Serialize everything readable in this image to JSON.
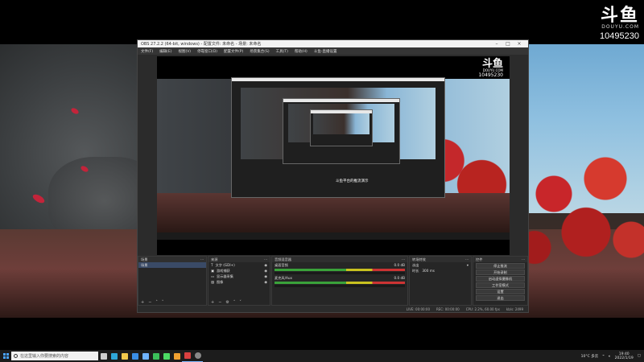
{
  "watermark": {
    "logo": "斗鱼",
    "sub": "DOUYU.COM",
    "room_id": "10495230"
  },
  "obs": {
    "title": "OBS 27.2.2 (64-bit, windows) - 配置文件: 未命名 - 场景: 未命名",
    "menu": [
      "文件(F)",
      "编辑(E)",
      "视图(V)",
      "停靠窗口(D)",
      "配置文件(P)",
      "场景集合(S)",
      "工具(T)",
      "帮助(H)",
      "斗鱼-直播设置"
    ],
    "preview_logo": {
      "logo": "斗鱼",
      "sub": "DOUYU.COM",
      "room_id": "10495230"
    },
    "preview_caption": "斗鱼平台的推流演示",
    "scenes_header": "场景",
    "scenes": [
      "场景"
    ],
    "sources_header": "来源",
    "sources": [
      "文字 (GDI+)",
      "游戏捕获",
      "显示器采集",
      "图像"
    ],
    "mixer_header": "音频混音器",
    "mixer_channels": [
      {
        "name": "桌面音频",
        "db": "0.0 dB"
      },
      {
        "name": "麦克风/Aux",
        "db": "0.0 dB"
      }
    ],
    "transitions_header": "转场特效",
    "transition_type": "淡出",
    "duration_label": "时长",
    "duration_value": "300 ms",
    "controls_header": "控件",
    "controls": [
      "停止推流",
      "开始录制",
      "启动虚拟摄像机",
      "工作室模式",
      "设置",
      "退出"
    ],
    "status": {
      "live": "LIVE: 00:00:00",
      "rec": "REC: 00:00:00",
      "cpu": "CPU: 2.2%, 60.00 fps",
      "kbps": "kb/s: 2499"
    }
  },
  "taskbar": {
    "search_placeholder": "在这里输入你要搜索的内容",
    "apps": [
      {
        "icon": "task-view-icon",
        "color": "#cfcfcf"
      },
      {
        "icon": "edge-icon",
        "color": "#2fa6d8"
      },
      {
        "icon": "explorer-icon",
        "color": "#f2c94c"
      },
      {
        "icon": "store-icon",
        "color": "#3a8ee6"
      },
      {
        "icon": "mail-icon",
        "color": "#6fb3ff"
      },
      {
        "icon": "wechat-icon",
        "color": "#3bbf5a"
      },
      {
        "icon": "app-green-icon",
        "color": "#4cd964"
      },
      {
        "icon": "app-orange-icon",
        "color": "#f0a030"
      },
      {
        "icon": "app-red-icon",
        "color": "#d94040"
      },
      {
        "icon": "obs-icon",
        "color": "#888888"
      }
    ],
    "weather": "10°C 多云",
    "time": "19:40",
    "date": "2022/1/19"
  }
}
